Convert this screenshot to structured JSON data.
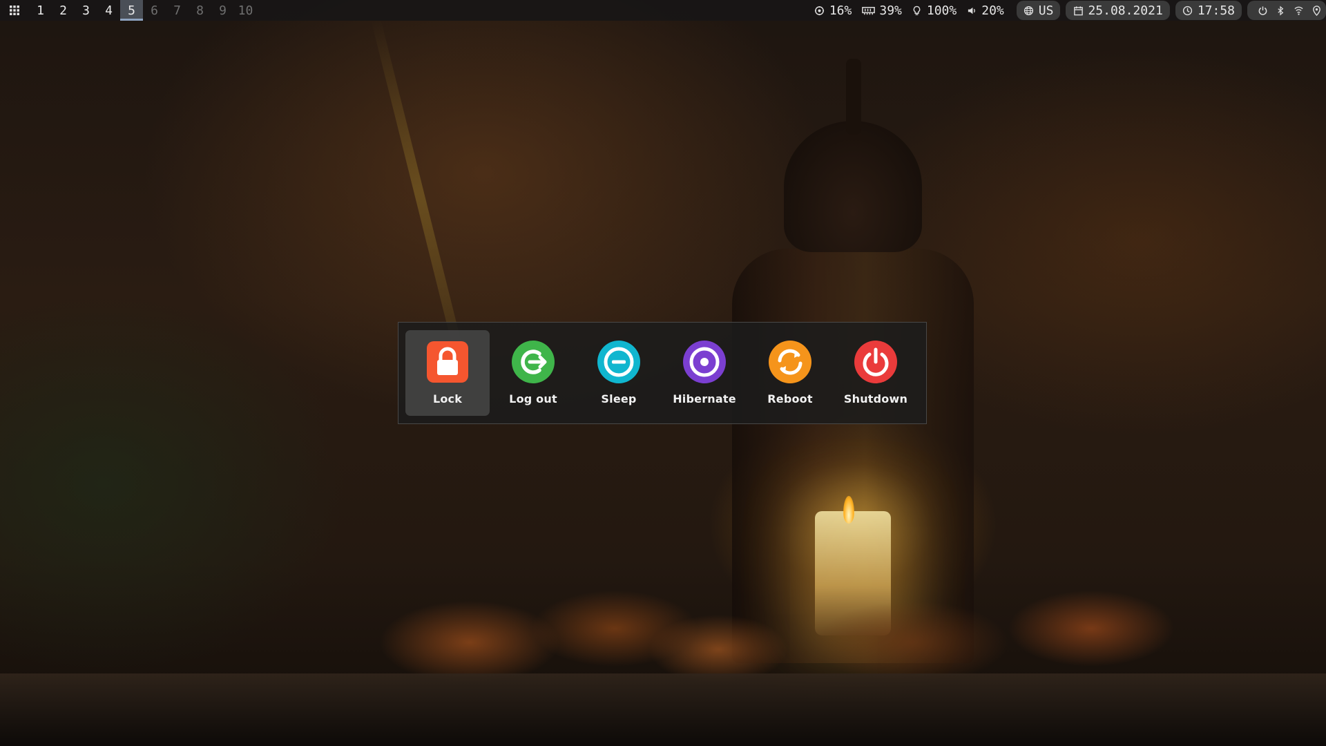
{
  "topbar": {
    "workspaces": [
      {
        "label": "1",
        "state": "occupied"
      },
      {
        "label": "2",
        "state": "occupied"
      },
      {
        "label": "3",
        "state": "occupied"
      },
      {
        "label": "4",
        "state": "occupied"
      },
      {
        "label": "5",
        "state": "active"
      },
      {
        "label": "6",
        "state": "empty"
      },
      {
        "label": "7",
        "state": "empty"
      },
      {
        "label": "8",
        "state": "empty"
      },
      {
        "label": "9",
        "state": "empty"
      },
      {
        "label": "10",
        "state": "empty"
      }
    ],
    "status": {
      "cpu": {
        "icon": "cpu-icon",
        "value": "16%"
      },
      "memory": {
        "icon": "memory-icon",
        "value": "39%"
      },
      "brightness": {
        "icon": "lightbulb-icon",
        "value": "100%"
      },
      "volume": {
        "icon": "speaker-icon",
        "value": "20%"
      },
      "keyboard": {
        "icon": "globe-icon",
        "value": "US"
      },
      "date": {
        "icon": "calendar-icon",
        "value": "25.08.2021"
      },
      "time": {
        "icon": "clock-icon",
        "value": "17:58"
      },
      "tray_icons": [
        "power-icon",
        "bluetooth-icon",
        "wifi-icon",
        "location-icon"
      ]
    }
  },
  "power_menu": {
    "items": [
      {
        "label": "Lock",
        "icon": "lock-icon",
        "color": "#f5562f",
        "selected": true
      },
      {
        "label": "Log out",
        "icon": "logout-icon",
        "color": "#3fb54a",
        "selected": false
      },
      {
        "label": "Sleep",
        "icon": "sleep-icon",
        "color": "#10b6cf",
        "selected": false
      },
      {
        "label": "Hibernate",
        "icon": "hibernate-icon",
        "color": "#7b3fd1",
        "selected": false
      },
      {
        "label": "Reboot",
        "icon": "reboot-icon",
        "color": "#f5941b",
        "selected": false
      },
      {
        "label": "Shutdown",
        "icon": "power-icon",
        "color": "#ea3b3b",
        "selected": false
      }
    ]
  }
}
